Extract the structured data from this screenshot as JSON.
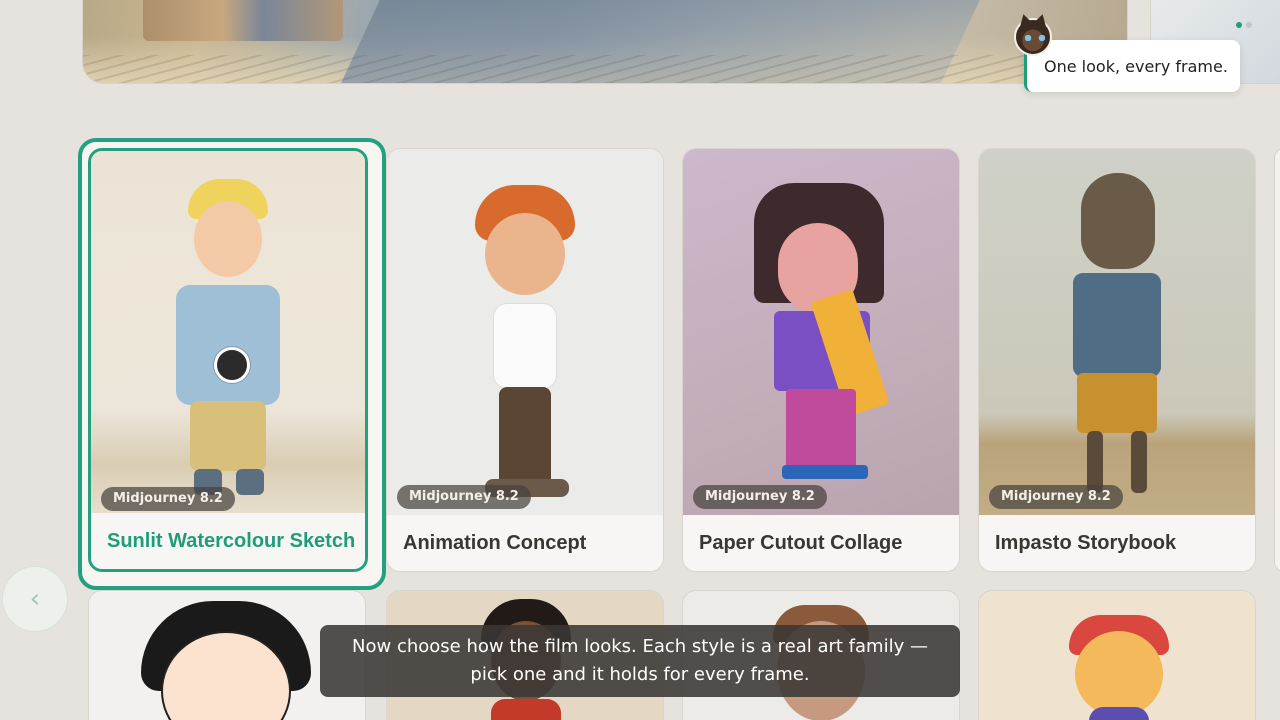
{
  "tooltip": {
    "text": "One look, every frame."
  },
  "carousel": {
    "prev_icon": "chevron-left-icon",
    "prev_glyph": "‹"
  },
  "styles": [
    {
      "model": "Midjourney 8.2",
      "name": "Sunlit Watercolour Sketch",
      "selected": true
    },
    {
      "model": "Midjourney 8.2",
      "name": "Animation Concept",
      "selected": false
    },
    {
      "model": "Midjourney 8.2",
      "name": "Paper Cutout Collage",
      "selected": false
    },
    {
      "model": "Midjourney 8.2",
      "name": "Impasto Storybook",
      "selected": false
    }
  ],
  "caption": {
    "text": "Now choose how the film looks. Each style is a real art family — pick one and it holds for every frame."
  },
  "colors": {
    "accent": "#23a17f",
    "background": "#e6e3de",
    "caption_bg": "#3a3734"
  }
}
